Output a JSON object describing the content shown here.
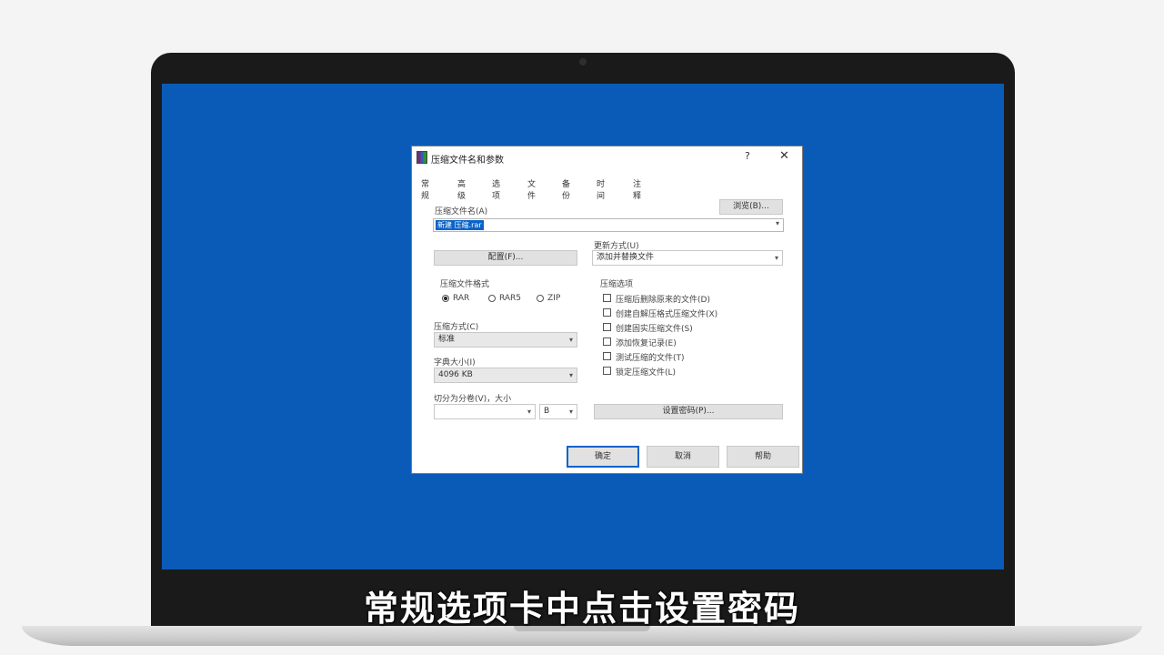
{
  "caption": "常规选项卡中点击设置密码",
  "dialog": {
    "title": "压缩文件名和参数",
    "help": "?",
    "close": "✕",
    "tabs": [
      "常规",
      "高级",
      "选项",
      "文件",
      "备份",
      "时间",
      "注释"
    ],
    "archive_name_label": "压缩文件名(A)",
    "browse_button": "浏览(B)...",
    "archive_name_value": "新建 压缩.rar",
    "profiles_button": "配置(F)...",
    "update_mode_label": "更新方式(U)",
    "update_mode_value": "添加并替换文件",
    "format_label": "压缩文件格式",
    "formats": [
      {
        "label": "RAR",
        "selected": true
      },
      {
        "label": "RAR5",
        "selected": false
      },
      {
        "label": "ZIP",
        "selected": false
      }
    ],
    "options_label": "压缩选项",
    "options": [
      "压缩后删除原来的文件(D)",
      "创建自解压格式压缩文件(X)",
      "创建固实压缩文件(S)",
      "添加恢复记录(E)",
      "测试压缩的文件(T)",
      "锁定压缩文件(L)"
    ],
    "method_label": "压缩方式(C)",
    "method_value": "标准",
    "dict_label": "字典大小(I)",
    "dict_value": "4096 KB",
    "split_label": "切分为分卷(V)，大小",
    "split_value": "",
    "split_unit": "B",
    "set_password_button": "设置密码(P)...",
    "ok_button": "确定",
    "cancel_button": "取消",
    "help_button": "帮助"
  }
}
